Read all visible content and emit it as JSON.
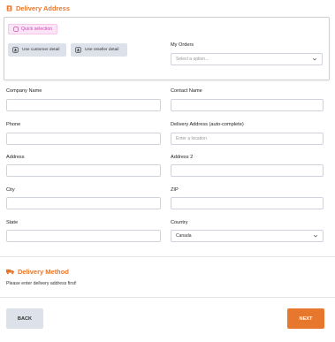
{
  "delivery_address": {
    "title": "Delivery Address",
    "quick_selection_label": "Quick selection",
    "use_customer_detail": "Use customer detail",
    "use_reseller_detail": "Use reseller detail",
    "my_orders": {
      "label": "My Orders",
      "placeholder": "Select a option..."
    }
  },
  "form": {
    "company_name": {
      "label": "Company Name",
      "value": ""
    },
    "contact_name": {
      "label": "Contact Name",
      "value": ""
    },
    "phone": {
      "label": "Phone",
      "value": ""
    },
    "delivery_address_auto": {
      "label": "Delivery Address (auto-complete)",
      "placeholder": "Enter a location"
    },
    "address": {
      "label": "Address",
      "value": ""
    },
    "address2": {
      "label": "Address 2",
      "value": ""
    },
    "city": {
      "label": "City",
      "value": ""
    },
    "zip": {
      "label": "ZIP",
      "value": ""
    },
    "state": {
      "label": "State",
      "value": ""
    },
    "country": {
      "label": "Country",
      "value": "Canada"
    }
  },
  "delivery_method": {
    "title": "Delivery Method",
    "note": "Please enter delivery address first!"
  },
  "footer": {
    "back_label": "BACK",
    "next_label": "NEXT"
  },
  "colors": {
    "accent": "#e8772e",
    "chip_bg": "#fbe4f6",
    "chip_text": "#c44db2",
    "secondary_button": "#dde2ea"
  },
  "icons": {
    "address_section": "address-book-icon",
    "quick_selection": "sparkle-icon",
    "customer": "user-badge-icon",
    "reseller": "user-badge-icon",
    "method_section": "truck-icon",
    "select": "chevron-down-icon"
  }
}
